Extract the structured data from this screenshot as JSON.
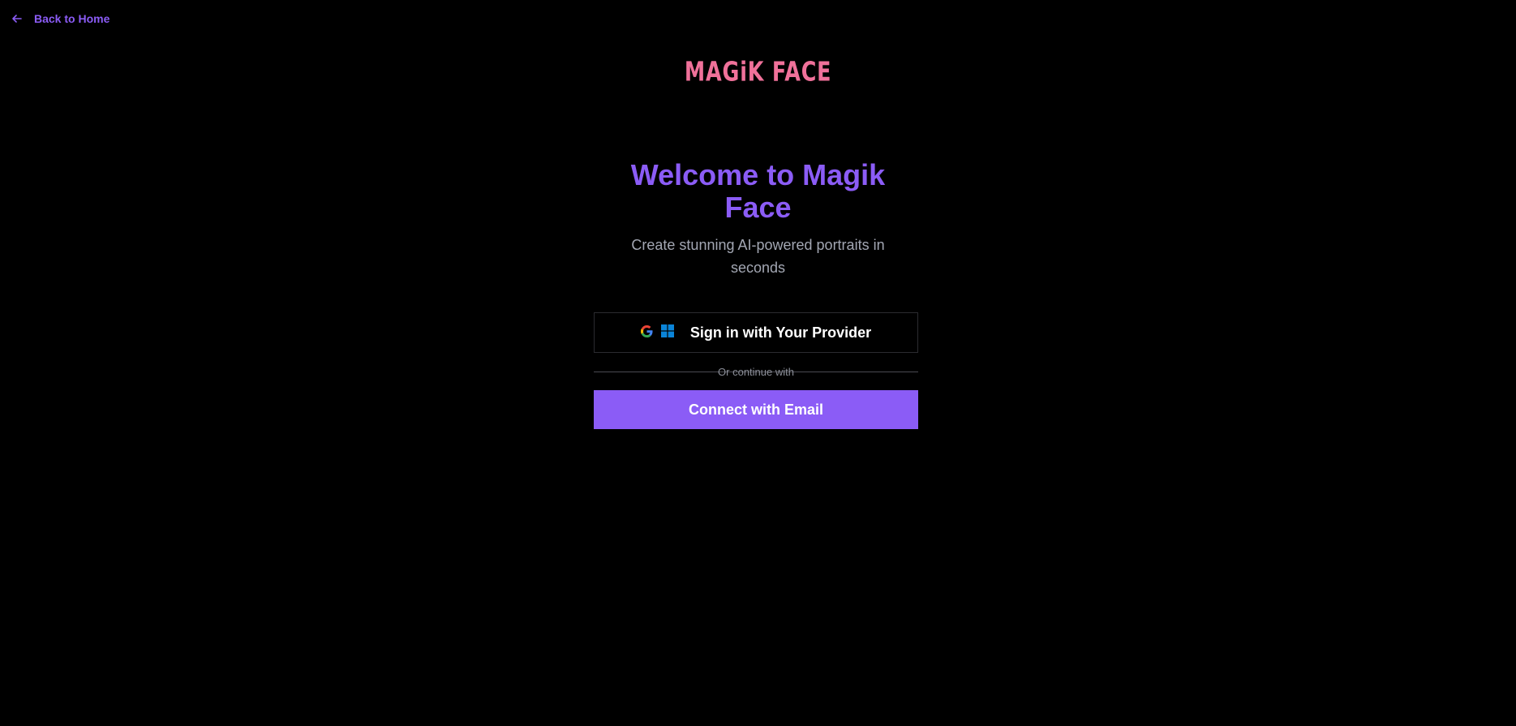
{
  "nav": {
    "back_label": "Back to Home",
    "back_icon": "arrow-left-icon"
  },
  "logo": {
    "text": "MAGiK FACE",
    "color": "#f0719a"
  },
  "hero": {
    "title": "Welcome to Magik Face",
    "subtitle": "Create stunning AI-powered portraits in seconds"
  },
  "auth": {
    "provider_label": "Sign in with Your Provider",
    "provider_icons": [
      "google-icon",
      "microsoft-icon"
    ],
    "divider_label": "Or continue with",
    "email_label": "Connect with Email"
  },
  "colors": {
    "background": "#000000",
    "accent": "#8b5cf6",
    "subtitle": "#a3a7b3"
  }
}
